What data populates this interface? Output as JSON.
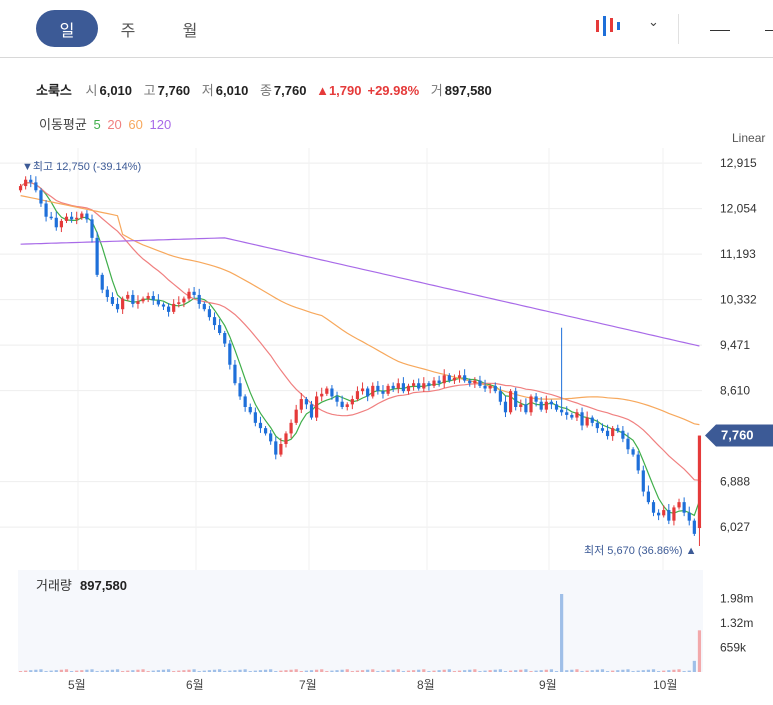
{
  "tabs": {
    "day": "일",
    "week": "주",
    "month": "월"
  },
  "stock": {
    "name": "소룩스",
    "open_label": "시",
    "open": "6,010",
    "high_label": "고",
    "high": "7,760",
    "low_label": "저",
    "low": "6,010",
    "close_label": "종",
    "close": "7,760",
    "change": "▲1,790",
    "change_pct": "+29.98%",
    "volume_label": "거",
    "volume": "897,580"
  },
  "moving_avg": {
    "label": "이동평균",
    "p5": "5",
    "p20": "20",
    "p60": "60",
    "p120": "120"
  },
  "colors": {
    "up": "#e53a3a",
    "down": "#1e6fd9",
    "ma5": "#3fae4a",
    "ma20": "#f08080",
    "ma60": "#f7a85c",
    "ma120": "#a86ae8",
    "accent": "#3c5a96"
  },
  "chart_data": {
    "type": "candlestick",
    "scale_label": "Linear",
    "y_ticks": [
      "12,915",
      "12,054",
      "11,193",
      "10,332",
      "9,471",
      "8,610",
      "6,888",
      "6,027"
    ],
    "ylim": [
      5500,
      13200
    ],
    "current_price": "7,760",
    "high_annotation": "▼최고 12,750 (-39.14%)",
    "low_annotation": "최저 5,670 (36.86%) ▲",
    "x_ticks": [
      "5월",
      "6월",
      "7월",
      "8월",
      "9월",
      "10월"
    ],
    "close": [
      12480,
      12600,
      12550,
      12400,
      12150,
      11900,
      11880,
      11700,
      11820,
      11900,
      11850,
      11880,
      11960,
      11850,
      11500,
      10800,
      10520,
      10380,
      10250,
      10150,
      10350,
      10420,
      10250,
      10300,
      10350,
      10400,
      10320,
      10240,
      10200,
      10100,
      10250,
      10280,
      10350,
      10480,
      10420,
      10250,
      10150,
      10000,
      9850,
      9700,
      9500,
      9100,
      8750,
      8500,
      8300,
      8200,
      8000,
      7900,
      7800,
      7650,
      7400,
      7600,
      7800,
      8000,
      8250,
      8450,
      8350,
      8100,
      8500,
      8550,
      8650,
      8500,
      8400,
      8300,
      8350,
      8450,
      8600,
      8650,
      8500,
      8700,
      8600,
      8550,
      8700,
      8650,
      8750,
      8600,
      8700,
      8750,
      8650,
      8750,
      8700,
      8800,
      8750,
      8900,
      8800,
      8850,
      8900,
      8800,
      8750,
      8800,
      8700,
      8650,
      8700,
      8600,
      8400,
      8200,
      8600,
      8300,
      8350,
      8200,
      8500,
      8400,
      8250,
      8400,
      8350,
      8250,
      8200,
      8150,
      8100,
      8200,
      7950,
      8100,
      8000,
      7900,
      7850,
      7750,
      7900,
      7850,
      7700,
      7500,
      7400,
      7100,
      6700,
      6500,
      6300,
      6250,
      6350,
      6150,
      6400,
      6500,
      6300,
      6150,
      5900,
      7760
    ],
    "volume_peak_marker": "1.98m",
    "volume": {
      "label": "거래량",
      "value": "897,580",
      "ticks": [
        "1.98m",
        "1.32m",
        "659k"
      ],
      "spike_index": 106,
      "spike_value": 2100000,
      "last_value": 897580
    }
  }
}
